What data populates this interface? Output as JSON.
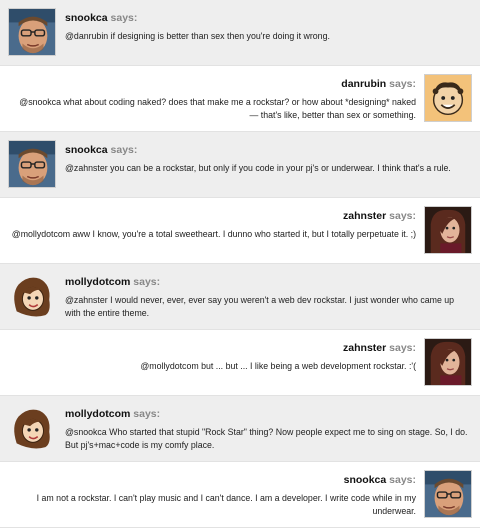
{
  "says_label": "says:",
  "messages": [
    {
      "author": "snookca",
      "side": "left",
      "avatar": "snookca-avatar",
      "text": "@danrubin if designing is better than sex then you're doing it wrong."
    },
    {
      "author": "danrubin",
      "side": "right",
      "avatar": "danrubin-avatar",
      "text": "@snookca what about coding naked? does that make me a rockstar? or how about *designing* naked — that's like, better than sex or something."
    },
    {
      "author": "snookca",
      "side": "left",
      "avatar": "snookca-avatar",
      "text": "@zahnster you can be a rockstar, but only if you code in your pj's or underwear. I think that's a rule."
    },
    {
      "author": "zahnster",
      "side": "right",
      "avatar": "zahnster-avatar",
      "text": "@mollydotcom aww I know, you're a total sweetheart. I dunno who started it, but I totally perpetuate it. ;)"
    },
    {
      "author": "mollydotcom",
      "side": "left",
      "avatar": "mollydotcom-avatar",
      "text": "@zahnster I would never, ever, ever say you weren't a web dev rockstar. I just wonder who came up with the entire theme."
    },
    {
      "author": "zahnster",
      "side": "right",
      "avatar": "zahnster-avatar",
      "text": "@mollydotcom but ... but ... I like being a web development rockstar. :'("
    },
    {
      "author": "mollydotcom",
      "side": "left",
      "avatar": "mollydotcom-avatar",
      "text": "@snookca Who started that stupid \"Rock Star\" thing? Now people expect me to sing on stage. So, I do. But pj's+mac+code is my comfy place."
    },
    {
      "author": "snookca",
      "side": "right",
      "avatar": "snookca-avatar",
      "text": "I am not a rockstar. I can't play music and I can't dance. I am a developer. I write code while in my underwear."
    }
  ]
}
